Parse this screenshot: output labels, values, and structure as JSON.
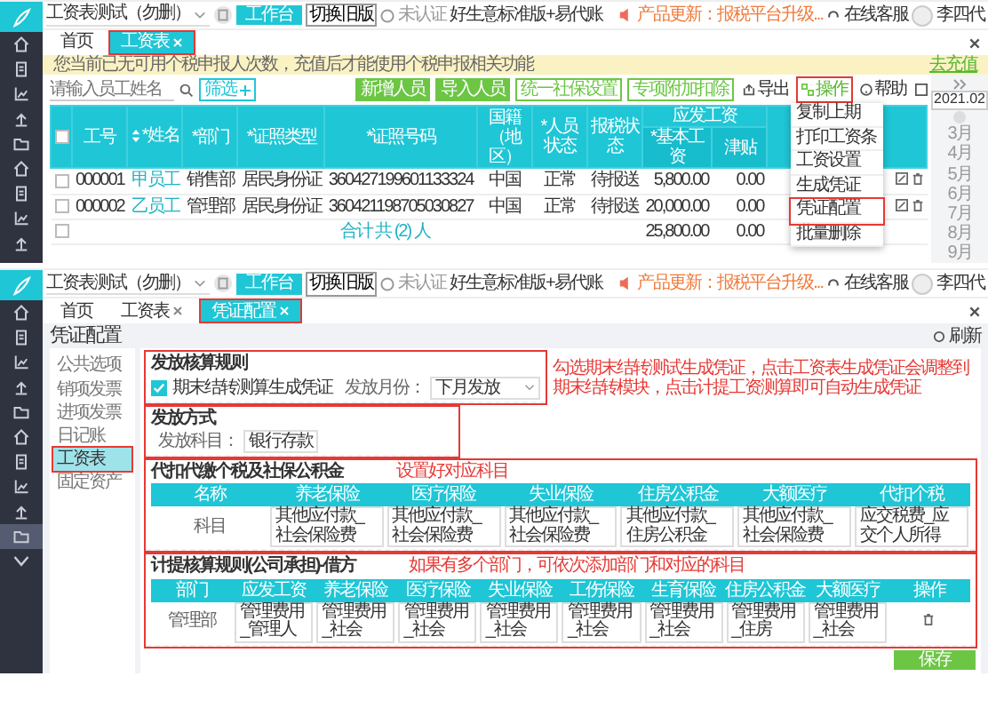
{
  "screens": [
    {
      "kind": "payroll",
      "header": {
        "company": "工资表测试（勿删）",
        "workbench_button": "工作台",
        "switch_button": "切换旧版",
        "auth_status": "未认证",
        "edition": "好生意标准版+易代账",
        "update_notice": "产品更新：报税平台升级...",
        "support": "在线客服",
        "user": "李四代"
      },
      "nav": [
        {
          "kind": "icon",
          "selected": false
        },
        {
          "kind": "icon",
          "selected": false
        },
        {
          "kind": "icon",
          "selected": false
        },
        {
          "kind": "icon",
          "selected": false
        },
        {
          "kind": "icon",
          "selected": false
        },
        {
          "kind": "icon",
          "selected": false
        },
        {
          "kind": "icon",
          "selected": false
        },
        {
          "kind": "icon",
          "selected": false
        },
        {
          "kind": "icon",
          "selected": false
        }
      ],
      "tabs": [
        {
          "label": "首页",
          "closable": false,
          "selected": false,
          "annotated": false
        },
        {
          "label": "工资表",
          "closable": true,
          "selected": true,
          "annotated": true
        }
      ],
      "notice": {
        "text": "您当前已无可用个税申报人次数，充值后才能使用个税申报相关功能",
        "action": "去充值"
      },
      "search": {
        "placeholder": "请输入员工姓名"
      },
      "filter_button": "筛选",
      "buttons": [
        {
          "label": "新增人员",
          "kind": "solid"
        },
        {
          "label": "导入人员",
          "kind": "solid"
        },
        {
          "label": "统一社保设置",
          "kind": "outline"
        },
        {
          "label": "专项附加扣除",
          "kind": "outline"
        }
      ],
      "tools": [
        {
          "label": "导出",
          "kind": "export",
          "annotated": false
        },
        {
          "label": "操作",
          "kind": "menu",
          "annotated": true
        },
        {
          "label": "帮助",
          "kind": "help",
          "annotated": false
        }
      ],
      "menu": [
        {
          "label": "复制上期",
          "annotated": false
        },
        {
          "label": "打印工资条",
          "annotated": false
        },
        {
          "label": "工资设置",
          "annotated": false
        },
        {
          "label": "生成凭证",
          "annotated": false
        },
        {
          "label": "凭证配置",
          "annotated": true
        },
        {
          "label": "批量删除",
          "annotated": false
        }
      ],
      "table": {
        "all_checked": false,
        "columns": [
          {
            "label": "工号",
            "sortable": false,
            "link": false
          },
          {
            "label": "*姓名",
            "sortable": true,
            "link": true
          },
          {
            "label": "*部门",
            "sortable": false,
            "link": false
          },
          {
            "label": "*证照类型",
            "sortable": false,
            "link": false
          },
          {
            "label": "*证照号码",
            "sortable": false,
            "link": false
          },
          {
            "label": "国籍（地区）",
            "sortable": false,
            "link": false
          },
          {
            "label": "*人员状态",
            "sortable": false,
            "link": false
          },
          {
            "label": "报税状态",
            "sortable": false,
            "link": false
          }
        ],
        "group": {
          "label": "应发工资",
          "columns": [
            "*基本工资",
            "津贴"
          ]
        },
        "rows": [
          {
            "checked": false,
            "cells": [
              "000001",
              "甲员工",
              "销售部",
              "居民身份证",
              "360427199601133324",
              "中国",
              "正常",
              "待报送"
            ],
            "salary": [
              "5,800.00",
              "0.00"
            ]
          },
          {
            "checked": false,
            "cells": [
              "000002",
              "乙员工",
              "管理部",
              "居民身份证",
              "360421198705030827",
              "中国",
              "正常",
              "待报送"
            ],
            "salary": [
              "20,000.00",
              "0.00"
            ]
          }
        ],
        "total": {
          "checked": false,
          "label": "合计 共 (2) 人",
          "salary": [
            "25,800.00",
            "0.00"
          ]
        }
      },
      "calendar": {
        "date": "2021.02",
        "months": [
          "3月",
          "4月",
          "5月",
          "6月",
          "7月",
          "8月",
          "9月"
        ]
      }
    },
    {
      "kind": "voucher",
      "header": {
        "company": "工资表测试（勿删）",
        "workbench_button": "工作台",
        "switch_button": "切换旧版",
        "auth_status": "未认证",
        "edition": "好生意标准版+易代账",
        "update_notice": "产品更新：报税平台升级...",
        "support": "在线客服",
        "user": "李四代"
      },
      "nav": [
        {
          "kind": "icon",
          "selected": false
        },
        {
          "kind": "icon",
          "selected": false
        },
        {
          "kind": "icon",
          "selected": false
        },
        {
          "kind": "icon",
          "selected": false
        },
        {
          "kind": "icon",
          "selected": false
        },
        {
          "kind": "icon",
          "selected": false
        },
        {
          "kind": "icon",
          "selected": false
        },
        {
          "kind": "icon",
          "selected": false
        },
        {
          "kind": "icon",
          "selected": false
        },
        {
          "kind": "icon",
          "selected": true
        },
        {
          "kind": "more",
          "selected": false
        }
      ],
      "tabs": [
        {
          "label": "首页",
          "closable": false,
          "selected": false,
          "annotated": false
        },
        {
          "label": "工资表",
          "closable": true,
          "selected": false,
          "annotated": false
        },
        {
          "label": "凭证配置",
          "closable": true,
          "selected": true,
          "annotated": true
        }
      ],
      "page_title": "凭证配置",
      "refresh": "刷新",
      "menu_items": [
        {
          "label": "公共选项",
          "selected": false,
          "annotated": false
        },
        {
          "label": "销项发票",
          "selected": false,
          "annotated": false
        },
        {
          "label": "进项发票",
          "selected": false,
          "annotated": false
        },
        {
          "label": "日记账",
          "selected": false,
          "annotated": false
        },
        {
          "label": "工资表",
          "selected": true,
          "annotated": true
        },
        {
          "label": "固定资产",
          "selected": false,
          "annotated": false
        }
      ],
      "issue_rule": {
        "title": "发放核算规则",
        "checkbox": {
          "label": "期末结转测算生成凭证",
          "checked": true
        },
        "month_label": "发放月份：",
        "month_value": "下月发放",
        "annotated": true,
        "note": "勾选期末结转测试生成凭证，点击工资表生成凭证会调整到期末结转模块，点击计提工资测算即可自动生成凭证"
      },
      "issue_method": {
        "title": "发放方式",
        "account_label": "发放科目：",
        "account_value": "银行存款",
        "annotated": true
      },
      "withholding": {
        "title": "代扣代缴个税及社保公积金",
        "note": "设置好对应科目",
        "annotated": true,
        "columns": [
          "名称",
          "养老保险",
          "医疗保险",
          "失业保险",
          "住房公积金",
          "大额医疗",
          "代扣个税"
        ],
        "rows": [
          {
            "label": "科目",
            "values": [
              "其他应付款_社会保险费",
              "其他应付款_社会保险费",
              "其他应付款_社会保险费",
              "其他应付款_住房公积金",
              "其他应付款_社会保险费",
              "应交税费_应交个人所得"
            ]
          }
        ]
      },
      "accrual": {
        "title": "计提核算规则(公司承担)-借方",
        "note": "如果有多个部门，可依次添加部门和对应的科目",
        "annotated": true,
        "columns": [
          "部门",
          "应发工资",
          "养老保险",
          "医疗保险",
          "失业保险",
          "工伤保险",
          "生育保险",
          "住房公积金",
          "大额医疗",
          "操作"
        ],
        "rows": [
          {
            "label": "管理部",
            "values": [
              "管理费用_管理人",
              "管理费用_社会",
              "管理费用_社会",
              "管理费用_社会",
              "管理费用_社会",
              "管理费用_社会",
              "管理费用_住房",
              "管理费用_社会"
            ]
          }
        ]
      },
      "save_button": "保存"
    }
  ]
}
